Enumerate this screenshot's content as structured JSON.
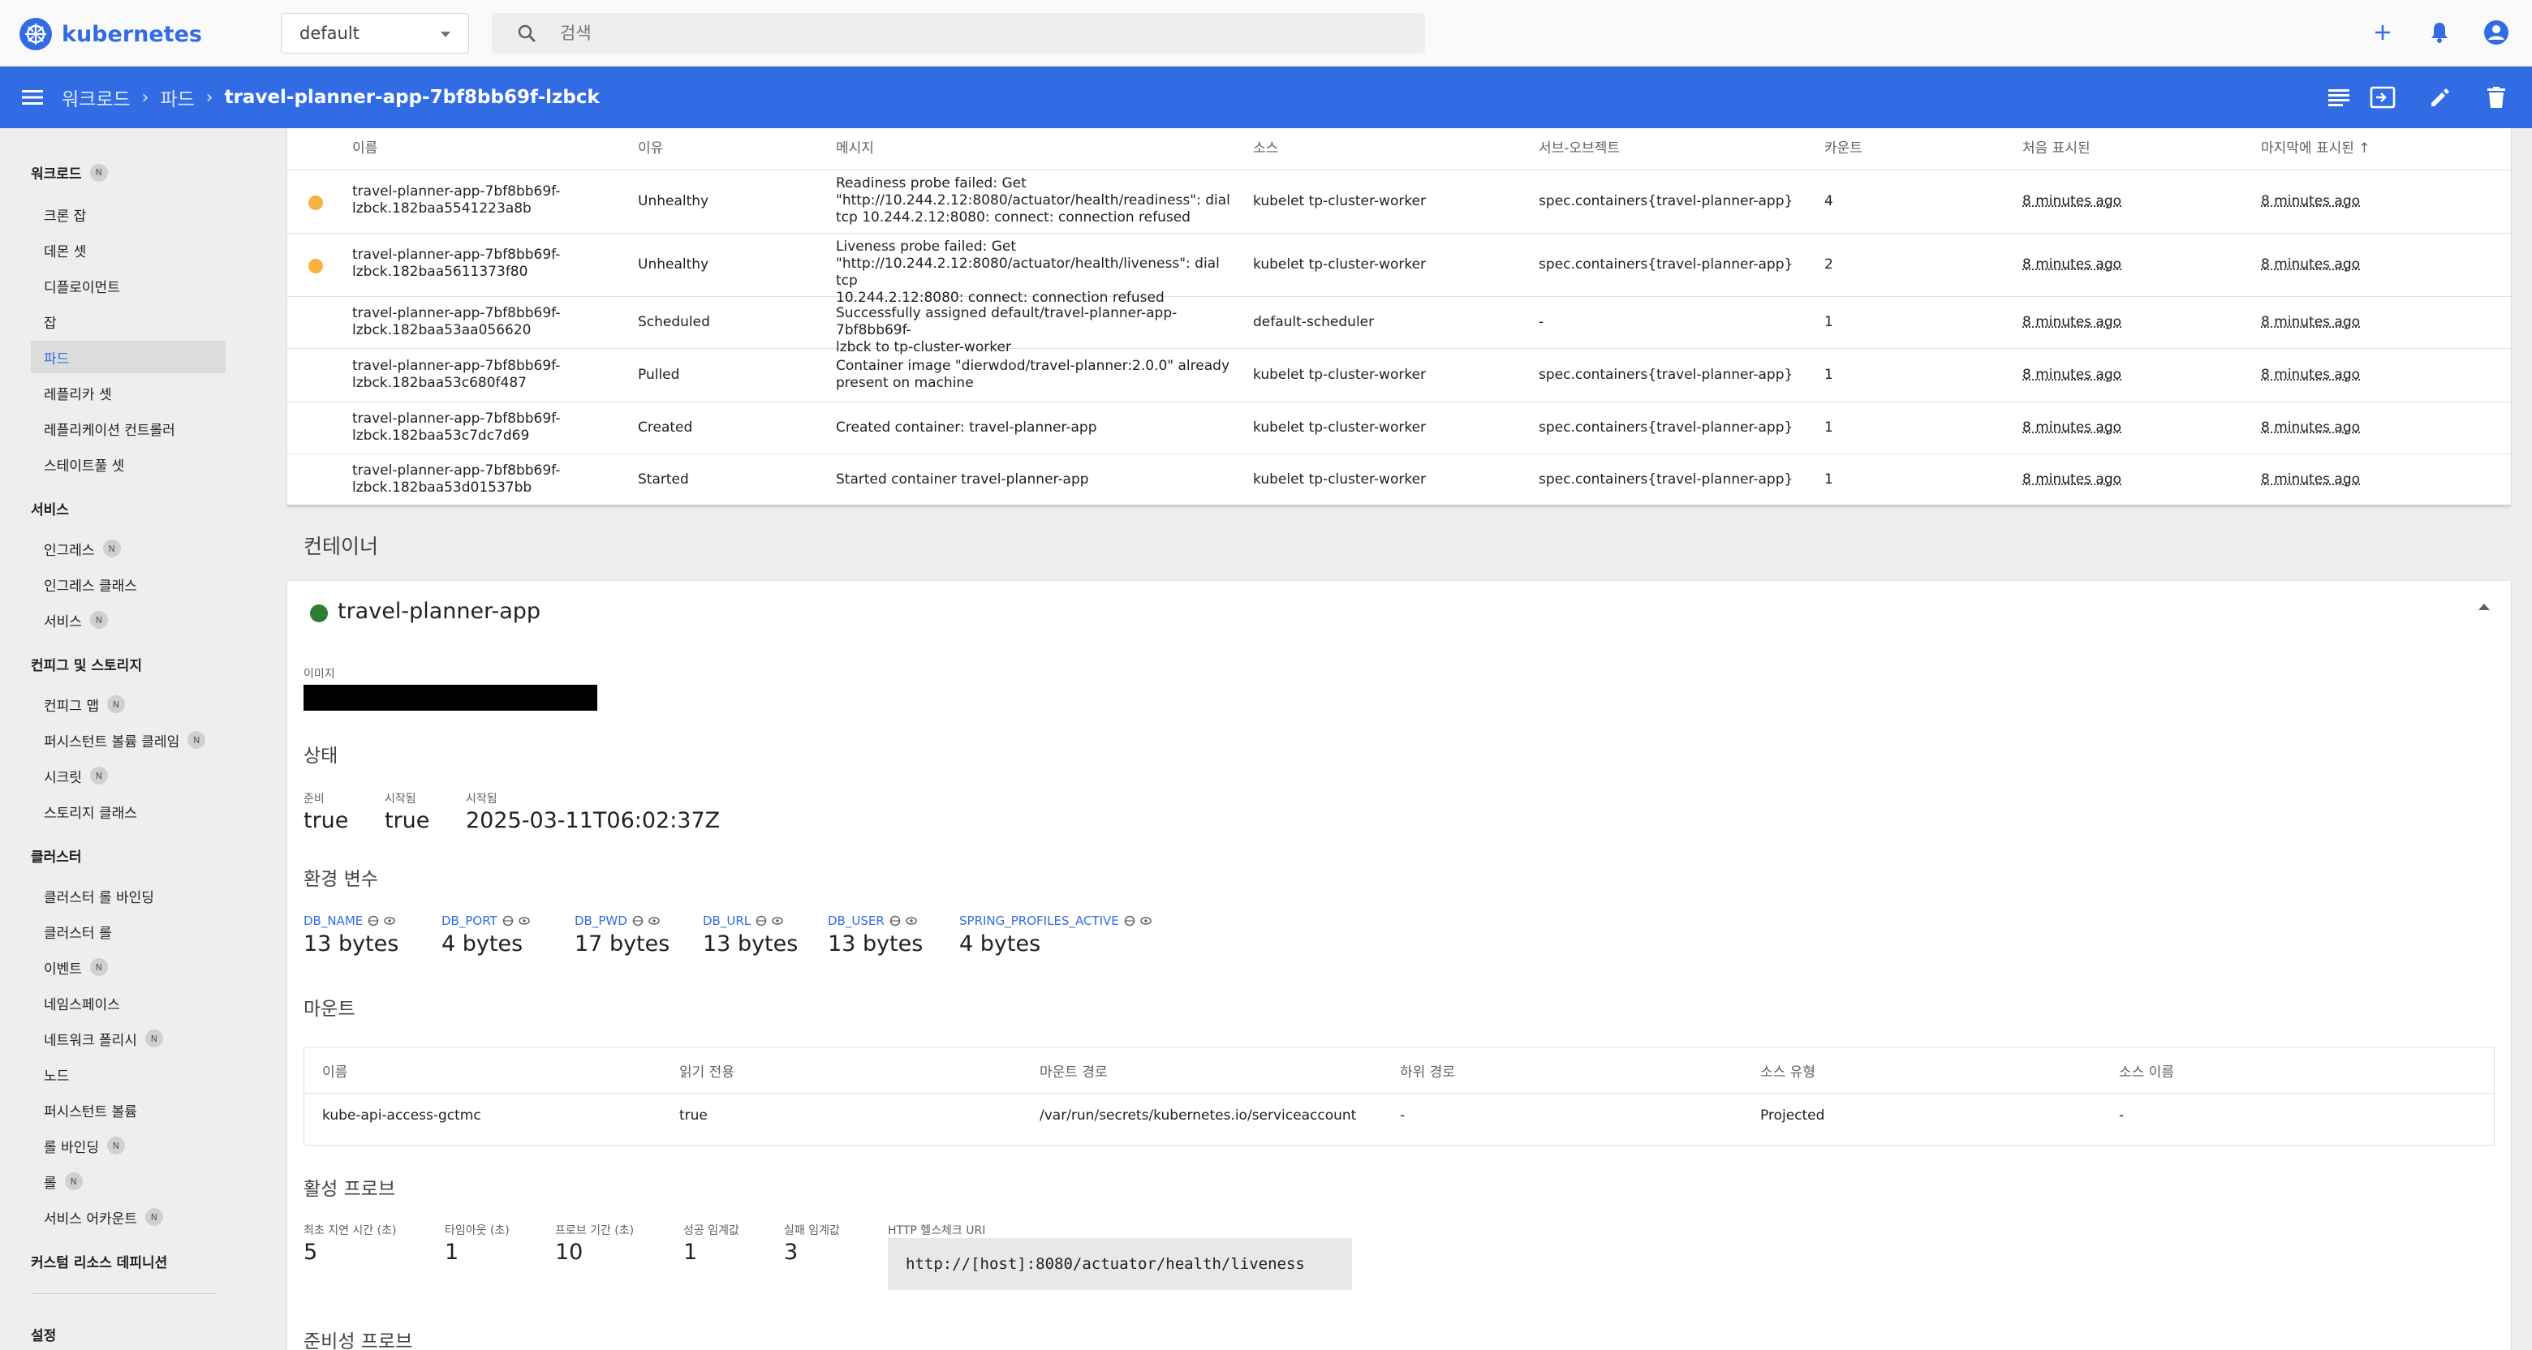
{
  "top_bar": {
    "brand": "kubernetes",
    "namespace": "default",
    "search_placeholder": "검색",
    "icons": [
      "plus-icon",
      "bell-icon",
      "account-icon"
    ]
  },
  "header": {
    "breadcrumb": [
      "워크로드",
      "파드"
    ],
    "current": "travel-planner-app-7bf8bb69f-lzbck",
    "actions": [
      "logs-icon",
      "exec-icon",
      "edit-icon",
      "delete-icon"
    ]
  },
  "sidebar": {
    "workloads": {
      "label": "워크로드",
      "badge": "N",
      "items": [
        "크론 잡",
        "데몬 셋",
        "디플로이먼트",
        "잡",
        "파드",
        "레플리카 셋",
        "레플리케이션 컨트롤러",
        "스테이트풀 셋"
      ]
    },
    "service": {
      "label": "서비스",
      "items": [
        "인그레스",
        "인그레스 클래스",
        "서비스"
      ],
      "badges": [
        "N",
        "",
        "N"
      ]
    },
    "config": {
      "label": "컨피그 및 스토리지",
      "items": [
        "컨피그 맵",
        "퍼시스턴트 볼륨 클레임",
        "시크릿",
        "스토리지 클래스"
      ],
      "badges": [
        "N",
        "N",
        "N",
        ""
      ]
    },
    "cluster": {
      "label": "클러스터",
      "items": [
        "클러스터 롤 바인딩",
        "클러스터 롤",
        "이벤트",
        "네임스페이스",
        "네트워크 폴리시",
        "노드",
        "퍼시스턴트 볼륨",
        "롤 바인딩",
        "롤",
        "서비스 어카운트"
      ],
      "badges": [
        "",
        "",
        "N",
        "",
        "N",
        "",
        "",
        "N",
        "N",
        "N"
      ]
    },
    "crd": "커스텀 리소스 데피니션",
    "settings": "설정",
    "active_item": "파드"
  },
  "events": {
    "columns": [
      "이름",
      "이유",
      "메시지",
      "소스",
      "서브-오브젝트",
      "카운트",
      "처음 표시된",
      "마지막에 표시된"
    ],
    "rows": [
      {
        "warn": true,
        "name1": "travel-planner-app-7bf8bb69f-",
        "name2": "lzbck.182baa5541223a8b",
        "reason": "Unhealthy",
        "msg1": "Readiness probe failed: Get",
        "msg2": "\"http://10.244.2.12:8080/actuator/health/readiness\": dial",
        "msg3": "tcp 10.244.2.12:8080: connect: connection refused",
        "source": "kubelet tp-cluster-worker",
        "subobject": "spec.containers{travel-planner-app}",
        "count": "4",
        "first": "8 minutes ago",
        "last": "8 minutes ago"
      },
      {
        "warn": true,
        "name1": "travel-planner-app-7bf8bb69f-",
        "name2": "lzbck.182baa5611373f80",
        "reason": "Unhealthy",
        "msg1": "Liveness probe failed: Get",
        "msg2": "\"http://10.244.2.12:8080/actuator/health/liveness\": dial tcp",
        "msg3": "10.244.2.12:8080: connect: connection refused",
        "source": "kubelet tp-cluster-worker",
        "subobject": "spec.containers{travel-planner-app}",
        "count": "2",
        "first": "8 minutes ago",
        "last": "8 minutes ago"
      },
      {
        "warn": false,
        "name1": "travel-planner-app-7bf8bb69f-",
        "name2": "lzbck.182baa53aa056620",
        "reason": "Scheduled",
        "msg1": "Successfully assigned default/travel-planner-app-7bf8bb69f-",
        "msg2": "lzbck to tp-cluster-worker",
        "msg3": "",
        "source": "default-scheduler",
        "subobject": "-",
        "count": "1",
        "first": "8 minutes ago",
        "last": "8 minutes ago"
      },
      {
        "warn": false,
        "name1": "travel-planner-app-7bf8bb69f-",
        "name2": "lzbck.182baa53c680f487",
        "reason": "Pulled",
        "msg1": "Container image \"dierwdod/travel-planner:2.0.0\" already",
        "msg2": "present on machine",
        "msg3": "",
        "source": "kubelet tp-cluster-worker",
        "subobject": "spec.containers{travel-planner-app}",
        "count": "1",
        "first": "8 minutes ago",
        "last": "8 minutes ago"
      },
      {
        "warn": false,
        "name1": "travel-planner-app-7bf8bb69f-",
        "name2": "lzbck.182baa53c7dc7d69",
        "reason": "Created",
        "msg1": "Created container: travel-planner-app",
        "msg2": "",
        "msg3": "",
        "source": "kubelet tp-cluster-worker",
        "subobject": "spec.containers{travel-planner-app}",
        "count": "1",
        "first": "8 minutes ago",
        "last": "8 minutes ago"
      },
      {
        "warn": false,
        "name1": "travel-planner-app-7bf8bb69f-",
        "name2": "lzbck.182baa53d01537bb",
        "reason": "Started",
        "msg1": "Started container travel-planner-app",
        "msg2": "",
        "msg3": "",
        "source": "kubelet tp-cluster-worker",
        "subobject": "spec.containers{travel-planner-app}",
        "count": "1",
        "first": "8 minutes ago",
        "last": "8 minutes ago"
      }
    ]
  },
  "containers": {
    "title": "컨테이너",
    "name": "travel-planner-app",
    "image_label": "이미지",
    "status": {
      "title": "상태",
      "ready_label": "준비",
      "ready": "true",
      "started_label": "시작됨",
      "started": "true",
      "started_at_label": "시작됨",
      "started_at": "2025-03-11T06:02:37Z"
    },
    "env": {
      "title": "환경 변수",
      "vars": [
        {
          "key": "DB_NAME",
          "value": "13 bytes"
        },
        {
          "key": "DB_PORT",
          "value": "4 bytes"
        },
        {
          "key": "DB_PWD",
          "value": "17 bytes"
        },
        {
          "key": "DB_URL",
          "value": "13 bytes"
        },
        {
          "key": "DB_USER",
          "value": "13 bytes"
        },
        {
          "key": "SPRING_PROFILES_ACTIVE",
          "value": "4 bytes"
        }
      ]
    },
    "mounts": {
      "title": "마운트",
      "columns": [
        "이름",
        "읽기 전용",
        "마운트 경로",
        "하위 경로",
        "소스 유형",
        "소스 이름"
      ],
      "row": [
        "kube-api-access-gctmc",
        "true",
        "/var/run/secrets/kubernetes.io/serviceaccount",
        "-",
        "Projected",
        "-"
      ]
    },
    "liveness": {
      "title": "활성 프로브",
      "labels": [
        "최초 지연 시간 (초)",
        "타임아웃 (초)",
        "프로브 기간 (초)",
        "성공 임계값",
        "실패 임계값",
        "HTTP 헬스체크 URI"
      ],
      "values": [
        "5",
        "1",
        "10",
        "1",
        "3"
      ],
      "uri": "http://[host]:8080/actuator/health/liveness"
    },
    "readiness_title": "준비성 프로브"
  },
  "colors": {
    "accent": "#326ce5",
    "warning": "#f6b23e",
    "ok": "#2e7d32"
  }
}
